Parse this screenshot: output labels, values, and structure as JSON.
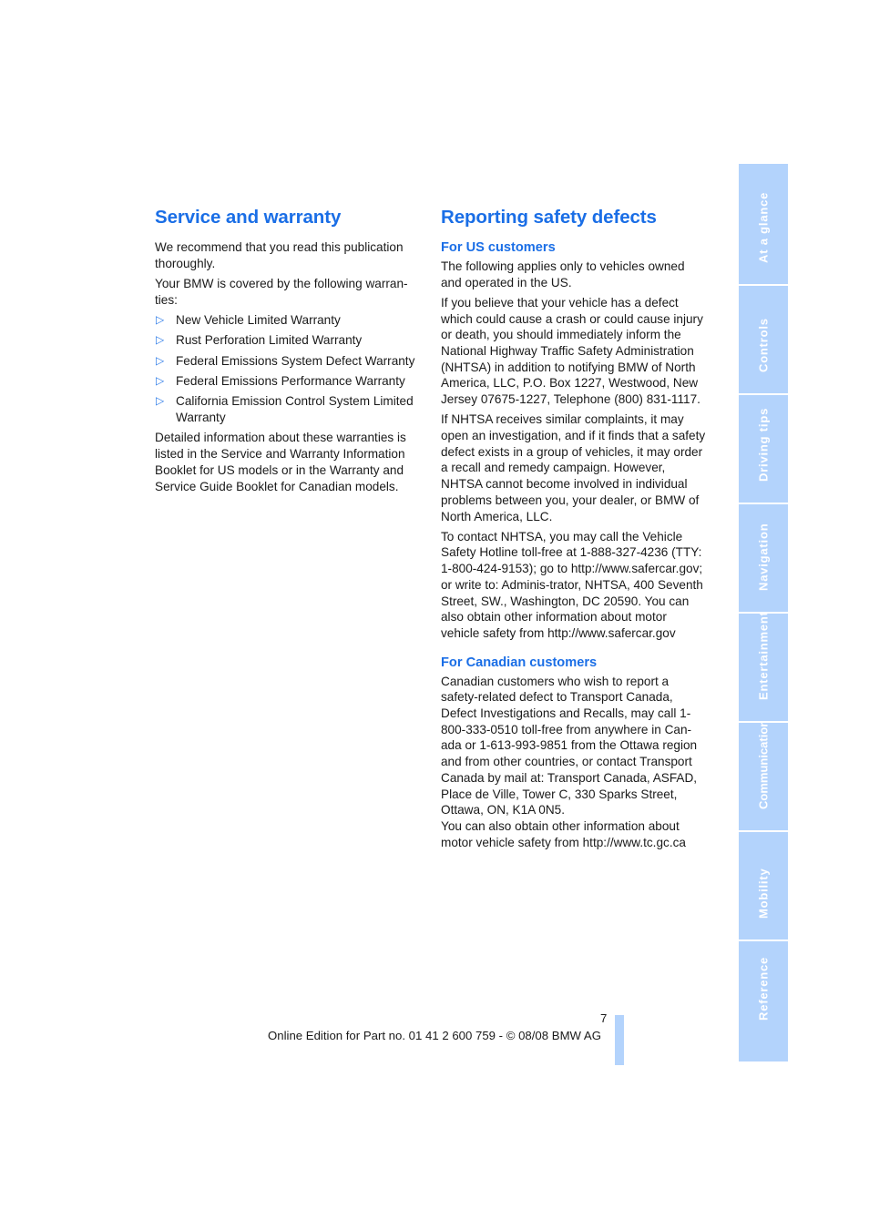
{
  "left_section": {
    "title": "Service and warranty",
    "intro": "We recommend that you read this publication thoroughly.",
    "covered_text": "Your BMW is covered by the following warran-ties:",
    "warranties": [
      "New Vehicle Limited Warranty",
      "Rust Perforation Limited Warranty",
      "Federal Emissions System Defect Warranty",
      "Federal Emissions Performance Warranty",
      "California Emission Control System Limited Warranty"
    ],
    "bullet_icon": "▷",
    "details": "Detailed information about these warranties is listed in the Service and Warranty Information Booklet for US models or in the Warranty and Service Guide Booklet for Canadian models."
  },
  "right_section": {
    "title": "Reporting safety defects",
    "us": {
      "heading": "For US customers",
      "paragraphs": [
        "The following applies only to vehicles owned and operated in the US.",
        "If you believe that your vehicle has a defect which could cause a crash or could cause injury or death, you should immediately inform the National Highway Traffic Safety Administration (NHTSA) in addition to notifying BMW of North America, LLC, P.O. Box 1227, Westwood, New Jersey 07675-1227, Telephone (800) 831-1117.",
        "If NHTSA receives similar complaints, it may open an investigation, and if it finds that a safety defect exists in a group of vehicles, it may order a recall and remedy campaign. However, NHTSA cannot become involved in individual problems between you, your dealer, or BMW of North America, LLC.",
        "To contact NHTSA, you may call the Vehicle Safety Hotline toll-free at 1-888-327-4236 (TTY: 1-800-424-9153); go to http://www.safercar.gov; or write to: Adminis-trator, NHTSA, 400 Seventh Street, SW., Washington, DC 20590. You can also obtain other information about motor vehicle safety from http://www.safercar.gov"
      ]
    },
    "canada": {
      "heading": "For Canadian customers",
      "paragraphs": [
        "Canadian customers who wish to report a safety-related defect to Transport Canada, Defect Investigations and Recalls, may call 1-800-333-0510 toll-free from anywhere in Can-ada or 1-613-993-9851 from the Ottawa region and from other countries, or contact Transport Canada by mail at: Transport Canada, ASFAD, Place de Ville, Tower C, 330 Sparks Street, Ottawa, ON, K1A 0N5.",
        "You can also obtain other information about motor vehicle safety from http://www.tc.gc.ca"
      ]
    }
  },
  "sidebar": {
    "tabs": [
      "At a glance",
      "Controls",
      "Driving tips",
      "Navigation",
      "Entertainment",
      "Communications",
      "Mobility",
      "Reference"
    ],
    "color": "#b3d3fc"
  },
  "footer": {
    "page_number": "7",
    "edition": "Online Edition for Part no. 01 41 2 600 759 - © 08/08 BMW AG"
  },
  "colors": {
    "heading": "#1a6ee6",
    "tab": "#b3d3fc"
  }
}
